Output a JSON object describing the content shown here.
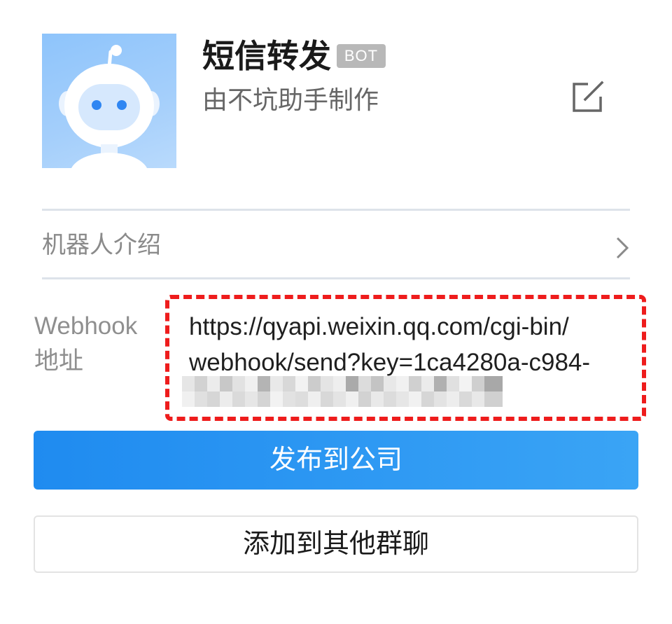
{
  "bot": {
    "name": "短信转发",
    "badge": "BOT",
    "subtitle": "由不坑助手制作",
    "avatar_icon": "robot-avatar",
    "edit_icon": "edit-icon"
  },
  "intro": {
    "label": "机器人介绍",
    "chevron_icon": "chevron-right-icon"
  },
  "webhook": {
    "label_line1": "Webhook",
    "label_line2": "地址",
    "url_line1": "https://qyapi.weixin.qq.com/cgi-bin/",
    "url_line2": "webhook/send?key=1ca4280a-c984-",
    "redacted": "pixelated-key-remainder"
  },
  "actions": {
    "publish_label": "发布到公司",
    "add_group_label": "添加到其他群聊"
  },
  "colors": {
    "primary": "#1f8bf0",
    "highlight_border": "#ee1c1c",
    "badge_bg": "#b8b8b8"
  }
}
